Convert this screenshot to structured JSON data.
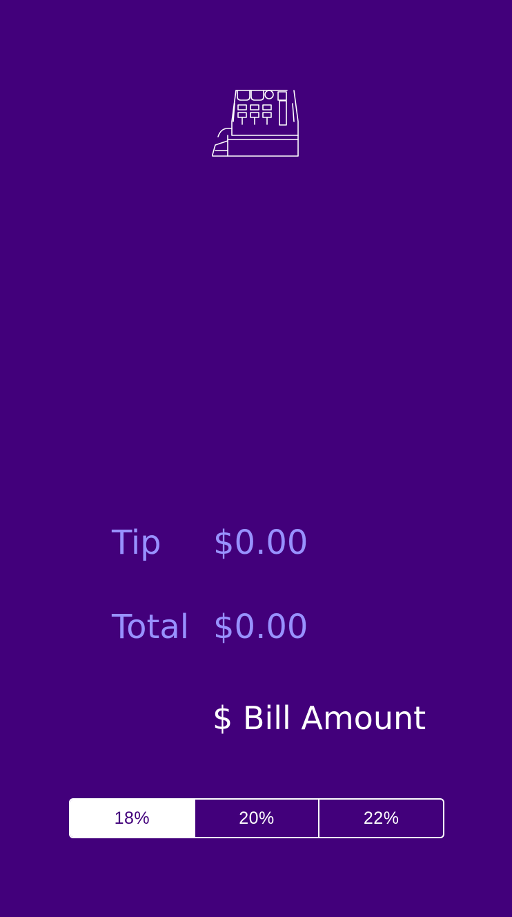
{
  "summary": {
    "tip_label": "Tip",
    "tip_value": "$0.00",
    "total_label": "Total",
    "total_value": "$0.00"
  },
  "bill": {
    "placeholder": "$ Bill Amount",
    "value": ""
  },
  "tip_options": [
    "18%",
    "20%",
    "22%"
  ],
  "selected_tip": "18%",
  "logo_icon": "cash-register-icon",
  "colors": {
    "background": "#42007b",
    "accent": "#9891ff",
    "foreground": "#ffffff"
  }
}
